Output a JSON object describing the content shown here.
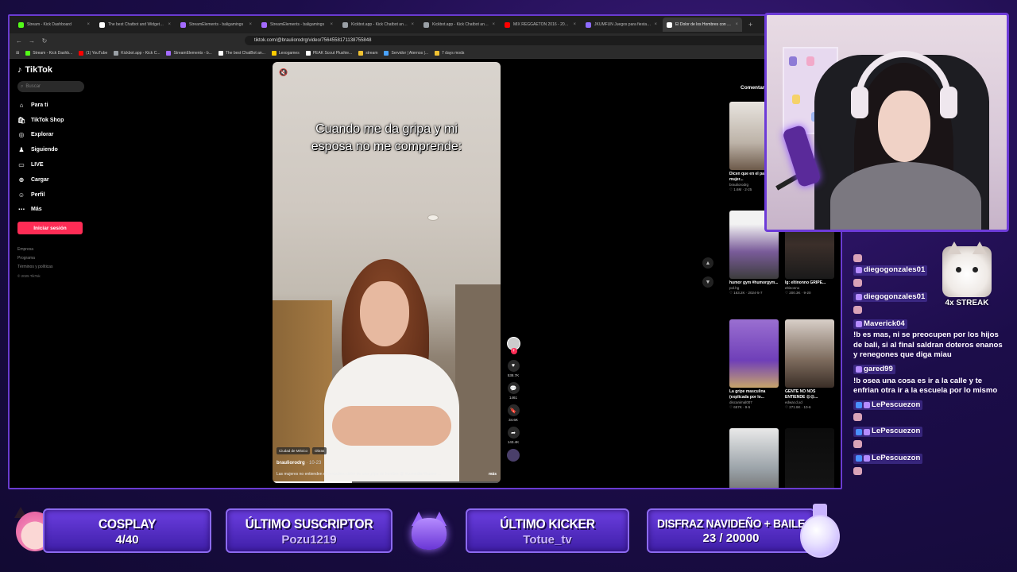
{
  "browser": {
    "tabs": [
      {
        "label": "Stream - Kick Dashboard",
        "color": "#53fc18"
      },
      {
        "label": "The best Chatbot and Widgets for K...",
        "color": "#ffffff"
      },
      {
        "label": "StreamElements - baligamings",
        "color": "#a46bff"
      },
      {
        "label": "StreamElements - baligamings",
        "color": "#a46bff"
      },
      {
        "label": "Kickbot.app - Kick Chatbot and Over...",
        "color": "#9aa0a6"
      },
      {
        "label": "Kickbot.app - Kick Chatbot and Over...",
        "color": "#9aa0a6"
      },
      {
        "label": "MIX REGGAETON 2016 - 2019 (NO E...",
        "color": "#ff0000"
      },
      {
        "label": "JKUMFUN Juegos para fiestas en P...",
        "color": "#8d6bff"
      },
      {
        "label": "El Dolor de los Hombres con Gri...",
        "color": "#ffffff",
        "active": true
      }
    ],
    "url": "tiktok.com/@brauliorodrg/video/7564558171138755848",
    "bookmarks": [
      {
        "label": "Stream - Kick Dashb...",
        "color": "#53fc18"
      },
      {
        "label": "(1) YouTube",
        "color": "#ff0000"
      },
      {
        "label": "Kickbot.app - Kick C...",
        "color": "#9aa0a6"
      },
      {
        "label": "StreamElements - b...",
        "color": "#a46bff"
      },
      {
        "label": "The best ChatBot an...",
        "color": "#ffffff"
      },
      {
        "label": "Lexogames",
        "color": "#ffcc00"
      },
      {
        "label": "PEAK Scout Plushie...",
        "color": "#ffffff"
      },
      {
        "label": "stream",
        "color": "#f1c232"
      },
      {
        "label": "Servidor | Aternos |...",
        "color": "#4aa3ff"
      },
      {
        "label": "7 days mods",
        "color": "#f1c232"
      }
    ]
  },
  "tiktok": {
    "logo": "TikTok",
    "search_placeholder": "Buscar",
    "nav": [
      {
        "label": "Para ti",
        "icon": "home-icon"
      },
      {
        "label": "TikTok Shop",
        "icon": "shop-icon"
      },
      {
        "label": "Explorar",
        "icon": "compass-icon"
      },
      {
        "label": "Siguiendo",
        "icon": "following-icon"
      },
      {
        "label": "LIVE",
        "icon": "live-icon"
      },
      {
        "label": "Cargar",
        "icon": "upload-icon"
      },
      {
        "label": "Perfil",
        "icon": "profile-icon"
      },
      {
        "label": "Más",
        "icon": "more-icon"
      }
    ],
    "login_button": "Iniciar sesión",
    "footer": [
      "Empresa",
      "Programa",
      "Términos y políticas"
    ],
    "copyright": "© 2025 TikTok",
    "video": {
      "caption": "Cuando me da gripa y mi esposa no me comprende:",
      "tags": [
        "Ciudad de México",
        "Obras"
      ],
      "author": "brauliorodrg",
      "date": "· 10-23",
      "description": "Las mujeres no entienden el verdadero dolor de una gripa de hombre 😩 #comedia #humor ...",
      "more": "más",
      "progress": 0.35
    },
    "actions": [
      {
        "icon": "heart-icon",
        "count": "538.7K"
      },
      {
        "icon": "comment-icon",
        "count": "1461"
      },
      {
        "icon": "bookmark-icon",
        "count": "34.6K"
      },
      {
        "icon": "share-icon",
        "count": "143.4K"
      }
    ],
    "comments_label": "Comentarios",
    "related": [
      {
        "title": "Dicen que en el parto la mujer...",
        "author": "brauliorodrg",
        "meta": "♡ 1.6M · 2-25"
      },
      {
        "title": "",
        "author": "",
        "meta": ""
      },
      {
        "title": "humor gym #humorgym...",
        "author": "pol.hg",
        "meta": "♡ 163.2K · 2024-5-7"
      },
      {
        "title": "lg: eltinonno GRIPE...",
        "author": "eltinonno",
        "meta": "♡ 200.3K · 9-20"
      },
      {
        "title": "La gripe masculina (explicada por lo...",
        "author": "discanimal007",
        "meta": "♡ 657K · 9-5"
      },
      {
        "title": "GENTE NO NOS ENTIENDE 😩😩...",
        "author": "edwar.d.xd",
        "meta": "♡ 271.8K · 10-6"
      },
      {
        "title": "",
        "author": "",
        "meta": ""
      },
      {
        "title": "",
        "author": "",
        "meta": ""
      }
    ]
  },
  "chat": {
    "messages": [
      {
        "user": "diegogonzales01",
        "text": ""
      },
      {
        "user": "diegogonzales01",
        "text": ""
      },
      {
        "user": "Maverick04",
        "text": "!b es mas, ni se preocupen por los hijos de bali, si al final saldran doteros enanos y renegones que diga miau"
      },
      {
        "user": "gared99",
        "text": "!b osea una cosa es ir a la calle y te enfrian otra ir a la escuela por lo mismo"
      },
      {
        "user": "LePescuezon",
        "text": ""
      },
      {
        "user": "LePescuezon",
        "text": ""
      },
      {
        "user": "LePescuezon",
        "text": ""
      }
    ],
    "streak": "4x STREAK"
  },
  "overlay": {
    "cosplay": {
      "label": "COSPLAY",
      "value": "4/40"
    },
    "subscriber": {
      "label": "ÚLTIMO SUSCRIPTOR",
      "value": "Pozu1219"
    },
    "kicker": {
      "label": "ÚLTIMO KICKER",
      "value": "Totue_tv"
    },
    "goal": {
      "label": "DISFRAZ NAVIDEÑO + BAILE",
      "value": "23 / 20000"
    }
  },
  "colors": {
    "accent": "#6a3bd1",
    "tiktok_red": "#fe2c55",
    "background": "#1c0d4a"
  }
}
